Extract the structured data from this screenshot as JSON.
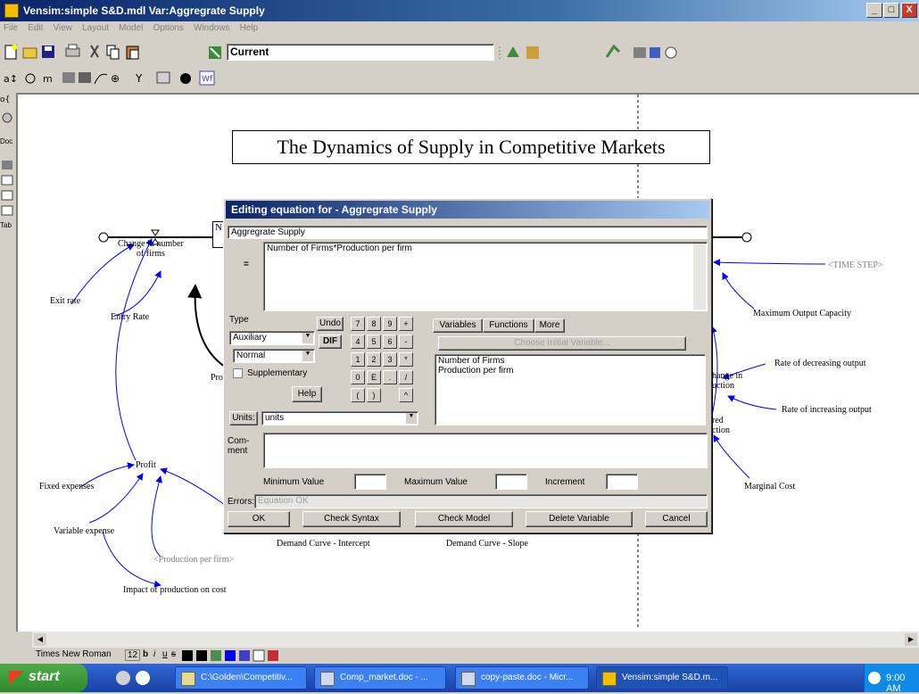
{
  "window": {
    "title": "Vensim:simple S&D.mdl Var:Aggregrate Supply",
    "minimize": "_",
    "maximize": "□",
    "close": "X"
  },
  "menu": [
    "File",
    "Edit",
    "View",
    "Layout",
    "Model",
    "Options",
    "Windows",
    "Help"
  ],
  "toolbar": {
    "run_name": "Current"
  },
  "lefttools": [
    "Doc",
    "Tab"
  ],
  "diagram": {
    "title": "The Dynamics of  Supply in Competitive Markets",
    "labels": {
      "change_number_firms": "Change in number\nof firms",
      "exit_rate": "Exit rate",
      "entry_rate": "Entry Rate",
      "profit": "Profit",
      "fixed_expenses": "Fixed expenses",
      "variable_expense": "Variable expense",
      "production_per_firm_shadow": "<Production per firm>",
      "impact_production_cost": "Impact of production on cost",
      "demand_intercept": "Demand Curve - Intercept",
      "demand_slope": "Demand Curve - Slope",
      "time_step": "<TIME STEP>",
      "max_output": "Maximum Output Capacity",
      "rate_decreasing": "Rate of decreasing output",
      "rate_increasing": "Rate of increasing output",
      "marginal_cost": "Marginal Cost",
      "change_in_production_partial": "hange in\nuction",
      "desired_production_partial": "red\nction",
      "pro_partial": "Pro",
      "n_partial": "N"
    }
  },
  "dialog": {
    "title": "Editing equation for - Aggregrate Supply",
    "var_name": "Aggregrate Supply",
    "eq_sign": "=",
    "equation": "Number of Firms*Production per firm",
    "type_label": "Type",
    "type_value": "Auxiliary",
    "subtype_value": "Normal",
    "supplementary": "Supplementary",
    "help": "Help",
    "units_label": "Units:",
    "units_value": "units",
    "comment_label": "Com-\nment",
    "undo": "Undo",
    "keypad": [
      "7",
      "8",
      "9",
      "+",
      "4",
      "5",
      "6",
      "-",
      "1",
      "2",
      "3",
      "*",
      "0",
      "E",
      ".",
      "/",
      "(",
      ")",
      "^"
    ],
    "dif": "DIF",
    "tabs": [
      "Variables",
      "Functions",
      "More"
    ],
    "choose_initial": "Choose Initial Variable...",
    "variables": [
      "Number of Firms",
      "Production per firm"
    ],
    "min_value": "Minimum Value",
    "max_value": "Maximum Value",
    "increment": "Increment",
    "errors_label": "Errors:",
    "errors_value": "Equation OK",
    "buttons": {
      "ok": "OK",
      "check_syntax": "Check Syntax",
      "check_model": "Check Model",
      "delete_variable": "Delete Variable",
      "cancel": "Cancel"
    }
  },
  "fontbar": {
    "font": "Times New Roman",
    "size": "12",
    "styles": [
      "b",
      "i",
      "u",
      "s"
    ]
  },
  "taskbar": {
    "start": "start",
    "tasks": [
      "C:\\Golden\\Competitiv...",
      "Comp_market.doc - ...",
      "copy-paste.doc - Micr...",
      "Vensim:simple S&D.m..."
    ],
    "clock": "9:00 AM"
  },
  "colors": {
    "title_blue": "#0a246a",
    "taskbar_blue": "#3168d5",
    "start_green": "#3c9a38",
    "link_blue": "#0000ff"
  }
}
